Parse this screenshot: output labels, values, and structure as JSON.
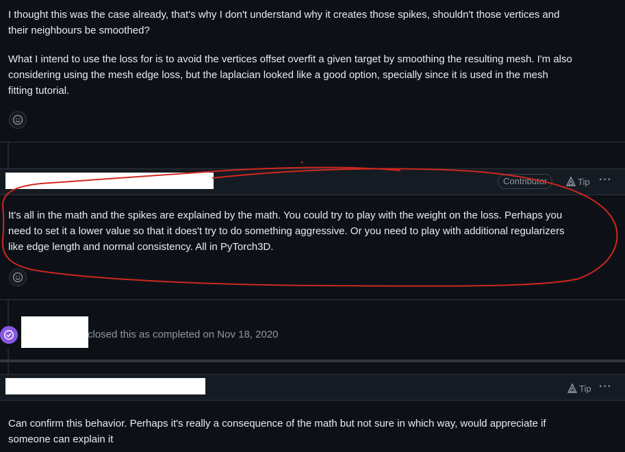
{
  "comment1": {
    "line1": "I thought this was the case already, that's why I don't understand why it creates those spikes, shouldn't those vertices and",
    "line2": "their neighbours be smoothed?",
    "para2_line1": "What I intend to use the loss for is to avoid the vertices offset overfit a given target by smoothing the resulting mesh. I'm also",
    "para2_line2": "considering using the mesh edge loss, but the laplacian looked like a good option, specially since it is used in the mesh",
    "para2_line3": "fitting tutorial."
  },
  "comment2": {
    "badge": "Contributor",
    "tip_label": "Tip",
    "more_label": "···",
    "line1": "It's all in the math and the spikes are explained by the math. You could try to play with the weight on the loss. Perhaps you",
    "line2": "need to set it a lower value so that it does't try to do something aggressive. Or you need to play with additional regularizers",
    "line3": "like edge length and normal consistency. All in PyTorch3D."
  },
  "event": {
    "text": "closed this as completed on Nov 18, 2020",
    "icon_color": "#8957e5"
  },
  "comment3": {
    "tip_label": "Tip",
    "more_label": "···",
    "line1": "Can confirm this behavior. Perhaps it's really a consequence of the math but not sure in which way, would appreciate if",
    "line2": "someone can explain it"
  },
  "colors": {
    "background": "#0d1117",
    "annotation_red": "#d0281e"
  }
}
